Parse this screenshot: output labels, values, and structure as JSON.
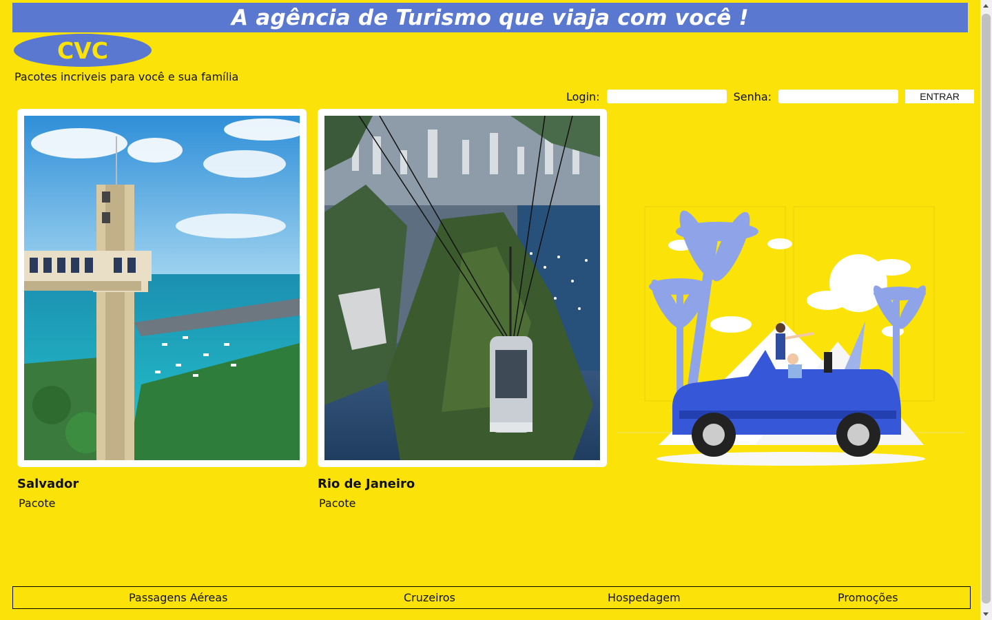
{
  "banner": {
    "text": "A agência de Turismo que viaja com você !"
  },
  "logo": {
    "text": "CVC"
  },
  "tagline": "Pacotes incriveis para você e sua família",
  "login": {
    "login_label": "Login:",
    "password_label": "Senha:",
    "login_value": "",
    "password_value": "",
    "button_label": "ENTRAR"
  },
  "packages": [
    {
      "title": "Salvador",
      "subtitle": "Pacote",
      "image": "elevator-bay-photo"
    },
    {
      "title": "Rio de Janeiro",
      "subtitle": "Pacote",
      "image": "cable-car-photo"
    }
  ],
  "illustration": "convertible-car-palms-illustration",
  "footer": {
    "items": [
      "Passagens Aéreas",
      "Cruzeiros",
      "Hospedagem",
      "Promoções"
    ]
  },
  "colors": {
    "background": "#fbe309",
    "accent": "#5a78d0"
  }
}
